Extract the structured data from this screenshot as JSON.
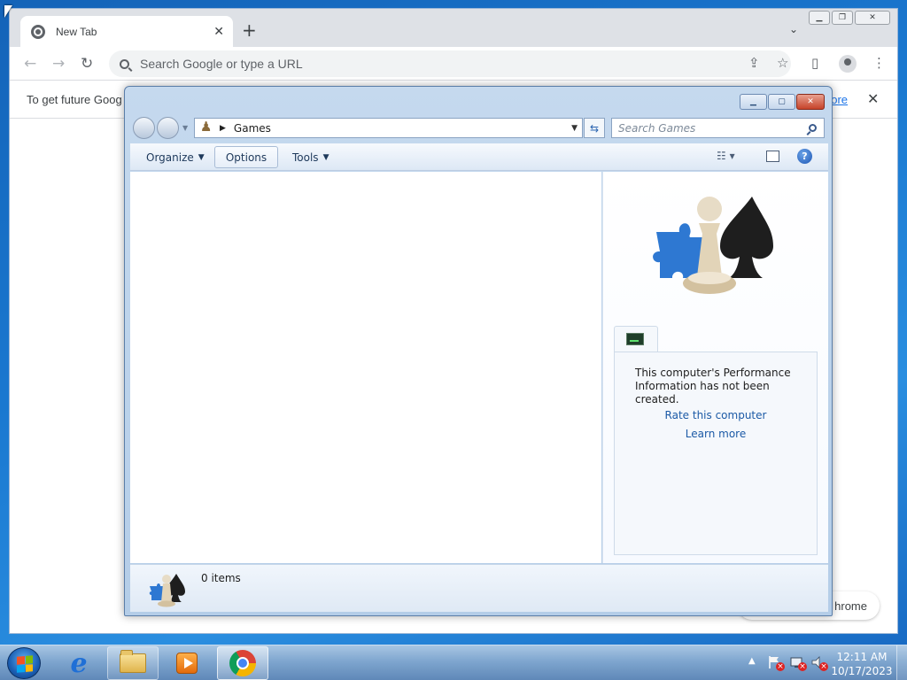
{
  "chrome": {
    "tab_title": "New Tab",
    "omnibox_placeholder": "Search Google or type a URL",
    "infobar_text": "To get future Goog",
    "infobar_link": "nore",
    "customize_label": "hrome"
  },
  "games": {
    "address": "Games",
    "search_placeholder": "Search Games",
    "commands": {
      "organize": "Organize",
      "options": "Options",
      "tools": "Tools"
    },
    "performance": {
      "message": "This computer's Performance Information has not been created.",
      "rate_link": "Rate this computer",
      "learn_link": "Learn more"
    },
    "item_count": "0 items"
  },
  "taskbar": {
    "time": "12:11 AM",
    "date": "10/17/2023"
  },
  "colors": {
    "accent": "#1c5aa6",
    "chrome_tabbar": "#dee1e6",
    "close_button": "#c6432a"
  },
  "icons": [
    "chrome-favicon",
    "search-icon",
    "share-icon",
    "star-icon",
    "sidepanel-icon",
    "profile-icon",
    "more-icon",
    "games-icon",
    "refresh-icon",
    "help-icon",
    "performance-icon",
    "start-orb",
    "ie-icon",
    "folder-icon",
    "media-player-icon",
    "chrome-icon",
    "flag-icon",
    "network-icon",
    "volume-icon"
  ]
}
